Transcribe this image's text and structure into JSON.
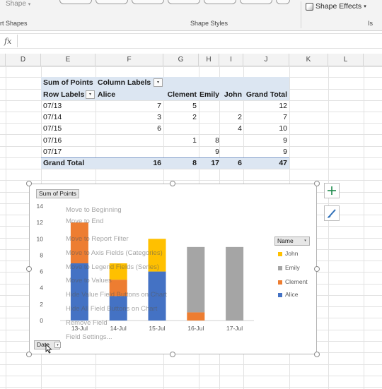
{
  "ribbon": {
    "shape_label": "Shape",
    "shape_effects_label": "Shape Effects",
    "groups": {
      "insert_shapes": "rt Shapes",
      "shape_styles": "Shape Styles",
      "more": "Is"
    }
  },
  "formula_bar": {
    "fx": "fx",
    "value": ""
  },
  "columns": [
    "D",
    "E",
    "F",
    "G",
    "H",
    "I",
    "J",
    "K",
    "L"
  ],
  "pivot": {
    "title": "Sum of Points",
    "column_labels": "Column Labels",
    "row_labels": "Row Labels",
    "headers": [
      "Alice",
      "Clement",
      "Emily",
      "John",
      "Grand Total"
    ],
    "rows": [
      {
        "label": "07/13",
        "alice": "7",
        "clement": "5",
        "emily": "",
        "john": "",
        "total": "12"
      },
      {
        "label": "07/14",
        "alice": "3",
        "clement": "2",
        "emily": "",
        "john": "2",
        "total": "7"
      },
      {
        "label": "07/15",
        "alice": "6",
        "clement": "",
        "emily": "",
        "john": "4",
        "total": "10"
      },
      {
        "label": "07/16",
        "alice": "",
        "clement": "1",
        "emily": "8",
        "john": "",
        "total": "9"
      },
      {
        "label": "07/17",
        "alice": "",
        "clement": "",
        "emily": "9",
        "john": "",
        "total": "9"
      }
    ],
    "grand_total": {
      "label": "Grand Total",
      "alice": "16",
      "clement": "8",
      "emily": "17",
      "john": "6",
      "total": "47"
    }
  },
  "chart_ui": {
    "value_field_button": "Sum of Points",
    "axis_field_button": "Date",
    "legend_field_button": "Name",
    "add_element_icon": "plus-icon",
    "style_icon": "brush-icon"
  },
  "context_menu_ghost": [
    "Move to Beginning",
    "Move to End",
    "Move to Report Filter",
    "Move to Axis Fields (Categories)",
    "Move to Legend Fields (Series)",
    "Move to Values",
    "Hide Value Field Buttons on Chart",
    "Hide All Field Buttons on Chart",
    "Remove Field",
    "Field Settings..."
  ],
  "chart_data": {
    "type": "bar",
    "stacked": true,
    "categories": [
      "13-Jul",
      "14-Jul",
      "15-Jul",
      "16-Jul",
      "17-Jul"
    ],
    "series": [
      {
        "name": "Alice",
        "color": "#4472c4",
        "values": [
          7,
          3,
          6,
          0,
          0
        ]
      },
      {
        "name": "Clement",
        "color": "#ed7d31",
        "values": [
          5,
          2,
          0,
          1,
          0
        ]
      },
      {
        "name": "Emily",
        "color": "#a5a5a5",
        "values": [
          0,
          0,
          0,
          8,
          9
        ]
      },
      {
        "name": "John",
        "color": "#ffc000",
        "values": [
          0,
          2,
          4,
          0,
          0
        ]
      }
    ],
    "legend_order": [
      "John",
      "Emily",
      "Clement",
      "Alice"
    ],
    "ylim": [
      0,
      14
    ],
    "y_ticks": [
      "0",
      "2",
      "4",
      "6",
      "8",
      "10",
      "12",
      "14"
    ],
    "grid": false,
    "legend_position": "right"
  }
}
